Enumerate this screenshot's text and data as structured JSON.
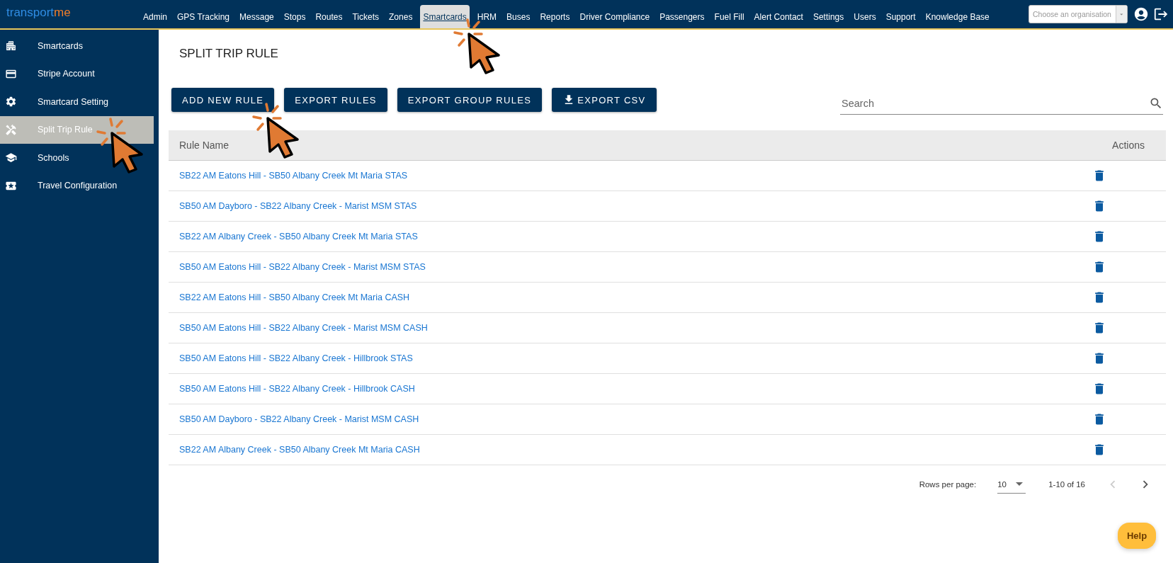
{
  "logo": {
    "main": "transport",
    "accent": "me"
  },
  "nav": [
    {
      "label": "Admin",
      "selected": false
    },
    {
      "label": "GPS Tracking",
      "selected": false
    },
    {
      "label": "Message",
      "selected": false
    },
    {
      "label": "Stops",
      "selected": false
    },
    {
      "label": "Routes",
      "selected": false
    },
    {
      "label": "Tickets",
      "selected": false
    },
    {
      "label": "Zones",
      "selected": false
    },
    {
      "label": "Smartcards",
      "selected": true
    },
    {
      "label": "HRM",
      "selected": false
    },
    {
      "label": "Buses",
      "selected": false
    },
    {
      "label": "Reports",
      "selected": false
    },
    {
      "label": "Driver Compliance",
      "selected": false
    },
    {
      "label": "Passengers",
      "selected": false
    },
    {
      "label": "Fuel Fill",
      "selected": false
    },
    {
      "label": "Alert Contact",
      "selected": false
    },
    {
      "label": "Settings",
      "selected": false
    },
    {
      "label": "Users",
      "selected": false
    },
    {
      "label": "Support",
      "selected": false
    },
    {
      "label": "Knowledge Base",
      "selected": false
    }
  ],
  "org_select": {
    "placeholder": "Choose an organisation"
  },
  "sidebar": {
    "items": [
      {
        "label": "Smartcards",
        "selected": false
      },
      {
        "label": "Stripe Account",
        "selected": false
      },
      {
        "label": "Smartcard Setting",
        "selected": false
      },
      {
        "label": "Split Trip Rule",
        "selected": true
      },
      {
        "label": "Schools",
        "selected": false
      },
      {
        "label": "Travel Configuration",
        "selected": false
      }
    ]
  },
  "page_title": "SPLIT TRIP RULE",
  "buttons": [
    {
      "label": "ADD NEW RULE",
      "kind": "plain"
    },
    {
      "label": "EXPORT RULES",
      "kind": "plain"
    },
    {
      "label": "EXPORT GROUP RULES",
      "kind": "plain"
    },
    {
      "label": "EXPORT CSV",
      "kind": "download"
    }
  ],
  "search": {
    "placeholder": "Search"
  },
  "table": {
    "columns": [
      "Rule Name",
      "Actions"
    ],
    "rows": [
      {
        "name": "SB22 AM Eatons Hill - SB50 Albany Creek Mt Maria STAS"
      },
      {
        "name": "SB50 AM Dayboro - SB22 Albany Creek - Marist MSM STAS"
      },
      {
        "name": "SB22 AM Albany Creek - SB50 Albany Creek Mt Maria STAS"
      },
      {
        "name": "SB50 AM Eatons Hill - SB22 Albany Creek - Marist MSM STAS"
      },
      {
        "name": "SB22 AM Eatons Hill - SB50 Albany Creek Mt Maria CASH"
      },
      {
        "name": "SB50 AM Eatons Hill - SB22 Albany Creek - Marist MSM CASH"
      },
      {
        "name": "SB50 AM Eatons Hill - SB22 Albany Creek - Hillbrook STAS"
      },
      {
        "name": "SB50 AM Eatons Hill - SB22 Albany Creek - Hillbrook CASH"
      },
      {
        "name": "SB50 AM Dayboro - SB22 Albany Creek - Marist MSM CASH"
      },
      {
        "name": "SB22 AM Albany Creek - SB50 Albany Creek Mt Maria CASH"
      }
    ]
  },
  "pagination": {
    "rows_label": "Rows per page:",
    "rows_value": "10",
    "range": "1-10 of 16",
    "prev_disabled": true,
    "next_disabled": false
  },
  "help": "Help",
  "annotations": [
    {
      "kind": "click"
    },
    {
      "kind": "click"
    },
    {
      "kind": "click"
    }
  ]
}
